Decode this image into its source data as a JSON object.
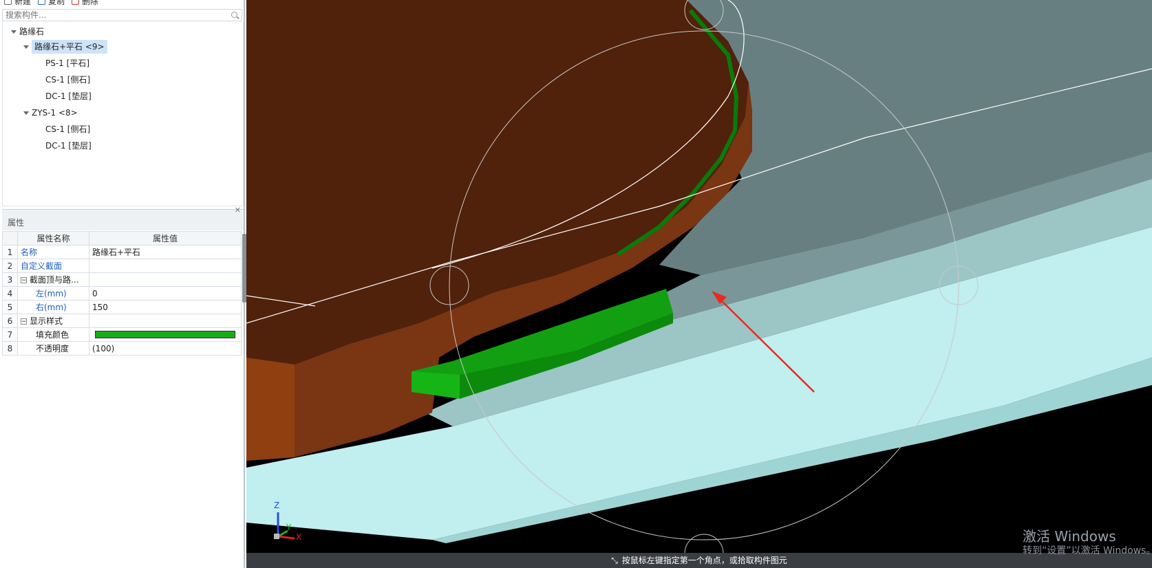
{
  "toolbar": {
    "new_label": "新建",
    "copy_label": "复制",
    "delete_label": "删除"
  },
  "search": {
    "placeholder": "搜索构件..."
  },
  "tree": {
    "root": "路缘石",
    "group1": "路缘石+平石 <9>",
    "g1_items": [
      "PS-1 [平石]",
      "CS-1 [侧石]",
      "DC-1 [垫层]"
    ],
    "group2": "ZYS-1 <8>",
    "g2_items": [
      "CS-1 [侧石]",
      "DC-1 [垫层]"
    ]
  },
  "properties": {
    "title": "属性",
    "col_name": "属性名称",
    "col_value": "属性值",
    "rows": [
      {
        "no": "1",
        "name": "名称",
        "value": "路缘石+平石"
      },
      {
        "no": "2",
        "name": "自定义截面",
        "value": ""
      },
      {
        "no": "3",
        "name": "截面顶与路...",
        "value": ""
      },
      {
        "no": "4",
        "name": "左(mm)",
        "value": "0"
      },
      {
        "no": "5",
        "name": "右(mm)",
        "value": "150"
      },
      {
        "no": "6",
        "name": "显示样式",
        "value": ""
      },
      {
        "no": "7",
        "name": "填充颜色",
        "value": ""
      },
      {
        "no": "8",
        "name": "不透明度",
        "value": "(100)"
      }
    ],
    "fill_color": "#1aab1a"
  },
  "viewport": {
    "axis_z": "Z",
    "axis_y": "Y",
    "axis_x": "X"
  },
  "status": {
    "text": "按鼠标左键指定第一个角点，或拾取构件图元"
  },
  "watermark": {
    "line1": "激活 Windows",
    "line2": "转到“设置”以激活 Windows。"
  }
}
